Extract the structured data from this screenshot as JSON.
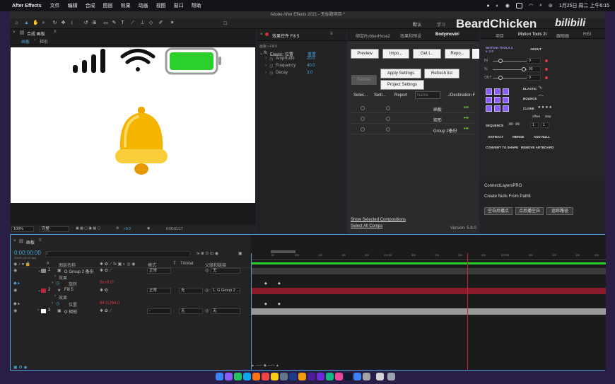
{
  "menubar": {
    "app": "After Effects",
    "items": [
      "文件",
      "编辑",
      "合成",
      "图层",
      "效果",
      "动画",
      "视图",
      "窗口",
      "帮助"
    ],
    "clock": "1月25日 周二 上午6:15"
  },
  "window_title": "Adobe After Effects 2021 - 无标题项目 *",
  "workspace": {
    "default": "默认",
    "learn": "学习"
  },
  "watermark": {
    "name": "BeardChicken",
    "site": "bilibili"
  },
  "comp_panel": {
    "title": "合成 画板",
    "breadcrumb_a": "画板",
    "breadcrumb_b": "矩形",
    "zoom": "100%",
    "quality": "完整",
    "exposure": "+0.0",
    "timecode": "0:00:01:17"
  },
  "fx_panel": {
    "title": "效果控件 Fill 5",
    "sub": "画板 • Fill 5",
    "effect_name": "Elastic: 位置",
    "reset": "重置",
    "params": [
      {
        "name": "Amplitude",
        "value": "20.0"
      },
      {
        "name": "Frequency",
        "value": "40.0"
      },
      {
        "name": "Decay",
        "value": "3.0"
      }
    ]
  },
  "bodymovin": {
    "tabs": [
      "绑定RubberHose2",
      "效果和预设",
      "Bodymovin"
    ],
    "buttons": [
      "Preview",
      "Impo...",
      "Get t...",
      "Repo..."
    ],
    "render": "Render",
    "apply_settings": "Apply Settings",
    "refresh_list": "Refresh list",
    "project_settings": "Project Settings",
    "col_selec": "Selec...",
    "col_setti": "Setti...",
    "col_report": "Report",
    "col_name_placeholder": "Name",
    "col_dest": "../Destination F",
    "rows": [
      "画板",
      "矩形",
      "Group 2备份"
    ],
    "row_dots": "•••",
    "show_selected": "Show Selected Compositions",
    "select_all": "Select All Comps",
    "version": "Version: 5.8.0"
  },
  "right_panel": {
    "tabs": [
      "项目",
      "Motion Tools 2",
      "跟随器",
      "RElI"
    ],
    "mt_logo": "MOTION TOOLS 2 v. 2.0",
    "about": "ABOUT",
    "sliders": [
      {
        "label": "IN",
        "value": "0"
      },
      {
        "label": "%",
        "value": "90"
      },
      {
        "label": "OUT",
        "value": "0"
      }
    ],
    "elastic": "ELASTIC",
    "bounce": "BOUNCE",
    "clone": "CLONE",
    "offset": "offset",
    "step": "step",
    "sequence": "SEQUENCE",
    "seq_a": "1",
    "seq_b": "1",
    "extract": "EXTRACT",
    "merge": "MERGE",
    "add_null": "ADD NULL",
    "convert": "CONVERT TO SHAPE",
    "remove_artboard": "REMOVE ARTBOARD",
    "connect": "ConnectLayersPRO",
    "nulls": "Create Nulls From Paths",
    "ctl_buttons": [
      "空白后播点",
      "点后播空白",
      "追踪路径"
    ]
  },
  "timeline": {
    "tab": "画板",
    "timecode": "0:00:00:00",
    "fps": "00000 (30.00 fps)",
    "headers": {
      "num": "#",
      "name": "图层名称",
      "mode": "模式",
      "t": "T",
      "trkmat": "TrkMat",
      "parent": "父级和链接"
    },
    "layers": [
      {
        "num": "1",
        "name": "G Group 2 备份",
        "mode": "正常",
        "trk": "",
        "parent": "无",
        "color": "#8a8a8a"
      },
      {
        "num": "2",
        "name": "Fill 5",
        "mode": "正常",
        "trk": "无",
        "parent": "1. G Group 2 ...",
        "color": "#c0283a"
      },
      {
        "num": "3",
        "name": "G 矩形",
        "mode": "-",
        "trk": "无",
        "parent": "无",
        "color": "#ffffff"
      }
    ],
    "sub_effect": "效果",
    "prop_rotate": "旋转",
    "prop_rotate_val": "0x+0.0°",
    "prop_pos": "位置",
    "prop_pos_val": "84.0,264.0",
    "ruler": [
      "0f",
      "05f",
      "10f",
      "15f",
      "20f",
      "01:00f",
      "05f",
      "10f",
      "15f",
      "20f",
      "02:00f",
      "05f",
      "10f",
      "15f",
      "20f",
      "03:0"
    ]
  },
  "colors": {
    "accent": "#4da3d9",
    "red_layer": "#8b1a2a",
    "green_bar": "#2bd02b",
    "bell": "#f5b400"
  }
}
